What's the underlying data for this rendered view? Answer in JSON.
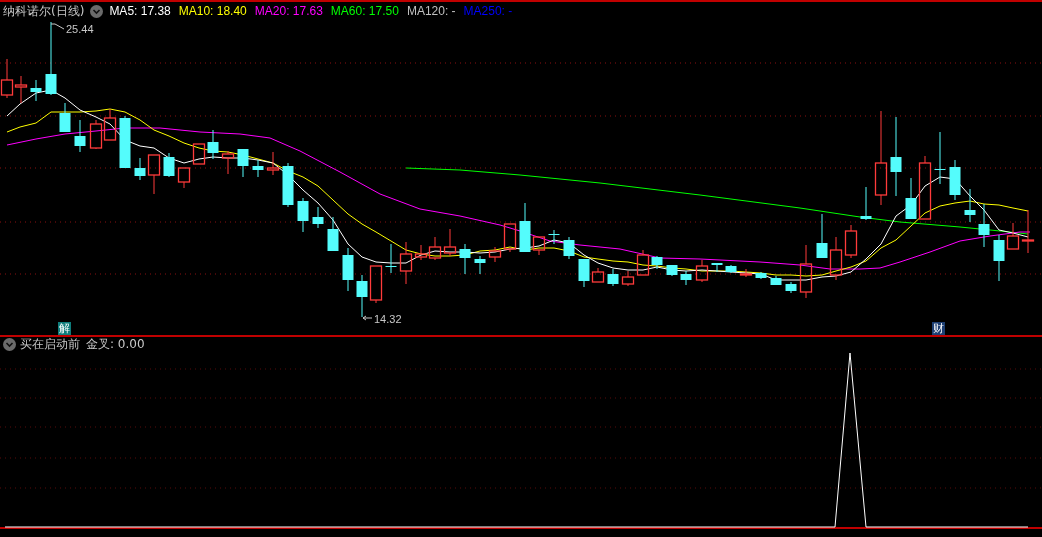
{
  "chart_header": {
    "title": "纳科诺尔(日线)",
    "indicators": [
      {
        "label": "MA5: 17.38",
        "color": "#ffffff"
      },
      {
        "label": "MA10: 18.40",
        "color": "#ffff00"
      },
      {
        "label": "MA20: 17.63",
        "color": "#ff00ff"
      },
      {
        "label": "MA60: 17.50",
        "color": "#00ff00"
      },
      {
        "label": "MA120: -",
        "color": "#c0c0c0"
      },
      {
        "label": "MA250: -",
        "color": "#0000ff"
      }
    ]
  },
  "price_chart": {
    "high_marker": "25.44",
    "low_marker": "14.32",
    "badges": [
      {
        "text": "解",
        "color": "#0e7c7b"
      },
      {
        "text": "财",
        "color": "#1d3f73"
      }
    ]
  },
  "indicator_panel": {
    "title": "买在启动前",
    "readout": "金叉: 0.00"
  }
}
